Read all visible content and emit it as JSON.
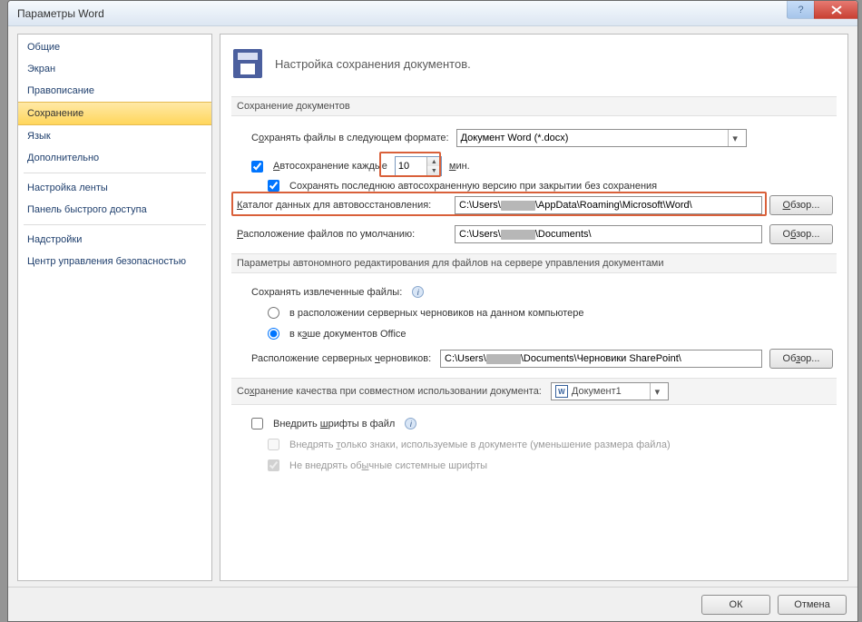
{
  "window": {
    "title": "Параметры Word"
  },
  "sidebar": {
    "items": [
      "Общие",
      "Экран",
      "Правописание",
      "Сохранение",
      "Язык",
      "Дополнительно",
      "Настройка ленты",
      "Панель быстрого доступа",
      "Надстройки",
      "Центр управления безопасностью"
    ],
    "selected_index": 3
  },
  "header": {
    "title": "Настройка сохранения документов."
  },
  "save_section": {
    "heading": "Сохранение документов",
    "format_label_pre": "С",
    "format_label_uchar": "о",
    "format_label_post": "хранять файлы в следующем формате:",
    "format_value": "Документ Word (*.docx)",
    "autosave_checked": true,
    "autosave_label_pre": "",
    "autosave_label_uchar": "А",
    "autosave_label_post": "втосохранение каждые",
    "autosave_value": "10",
    "autosave_unit_uchar": "м",
    "autosave_unit_post": "ин.",
    "keep_last_checked": true,
    "keep_last_text": "Сохранять последнюю автосохраненную версию при закрытии без сохранения",
    "autorecover_label_pre": "",
    "autorecover_label_uchar": "К",
    "autorecover_label_post": "аталог данных для автовосстановления:",
    "autorecover_path_pre": "C:\\Users\\",
    "autorecover_path_post": "\\AppData\\Roaming\\Microsoft\\Word\\",
    "default_loc_label_pre": "",
    "default_loc_label_uchar": "Р",
    "default_loc_label_post": "асположение файлов по умолчанию:",
    "default_loc_path_pre": "C:\\Users\\",
    "default_loc_path_post": "\\Documents\\",
    "browse1": "Обзор...",
    "browse2": "Обзор..."
  },
  "offline_section": {
    "heading": "Параметры автономного редактирования для файлов на сервере управления документами",
    "keep_files_label": "Сохранять извлеченные файлы:",
    "radio_server": "в расположении серверных черновиков на данном компьютере",
    "radio_cache_pre": "в к",
    "radio_cache_uchar": "э",
    "radio_cache_post": "ше документов Office",
    "drafts_label_pre": "Расположение серверных ",
    "drafts_label_uchar": "ч",
    "drafts_label_post": "ерновиков:",
    "drafts_path_pre": "C:\\Users\\",
    "drafts_path_post": "\\Documents\\Черновики SharePoint\\",
    "browse": "Обзор..."
  },
  "fidelity_section": {
    "heading_pre": "Со",
    "heading_uchar": "х",
    "heading_post": "ранение качества при совместном использовании документа:",
    "doc_name": "Документ1",
    "embed_label_pre": "Внедрить ",
    "embed_label_uchar": "ш",
    "embed_label_post": "рифты в файл",
    "embed_only_used_pre": "Внедрять ",
    "embed_only_used_uchar": "т",
    "embed_only_used_post": "олько знаки, используемые в документе (уменьшение размера файла)",
    "no_system_fonts_pre": "Не внедрять об",
    "no_system_fonts_uchar": "ы",
    "no_system_fonts_post": "чные системные шрифты"
  },
  "footer": {
    "ok": "ОК",
    "cancel": "Отмена"
  }
}
